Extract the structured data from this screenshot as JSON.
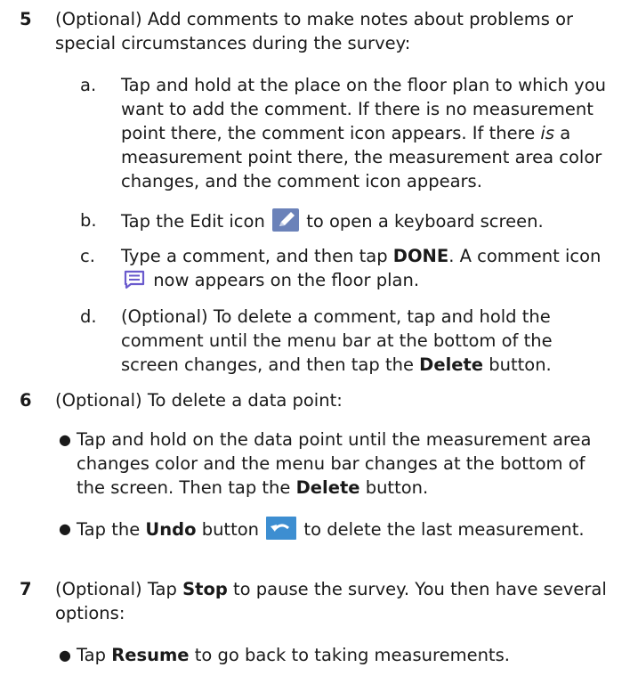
{
  "steps": [
    {
      "number": "5",
      "text": "(Optional) Add comments to make notes about problems or special circumstances during the survey:",
      "substeps": [
        {
          "letter": "a.",
          "text_1": "Tap and hold at the place on the floor plan to which you want to add the comment. If there is no measurement point there, the comment icon appears. If there ",
          "text_italic": "is",
          "text_2": " a measurement point there, the measurement area color changes, and the comment icon appears."
        },
        {
          "letter": "b.",
          "text_1": "Tap the Edit icon ",
          "icon": "edit-icon",
          "text_2": " to open a keyboard screen."
        },
        {
          "letter": "c.",
          "text_1": "Type a comment, and then tap ",
          "bold": "DONE",
          "text_2": ". A comment icon ",
          "icon": "comment-icon",
          "text_3": " now appears on the floor plan."
        },
        {
          "letter": "d.",
          "text_1": "(Optional) To delete a comment, tap and hold the comment until the menu bar at the bottom of the screen changes, and then tap the ",
          "bold": "Delete",
          "text_2": " button."
        }
      ]
    },
    {
      "number": "6",
      "text": "(Optional) To delete a data point:",
      "bullets": [
        {
          "text_1": "Tap and hold on the data point until the measurement area changes color and the menu bar changes at the bottom of the screen. Then tap the ",
          "bold": "Delete",
          "text_2": " button."
        },
        {
          "text_1": "Tap the ",
          "bold": "Undo",
          "text_2": " button ",
          "icon": "undo-icon",
          "text_3": " to delete the last measurement."
        }
      ]
    },
    {
      "number": "7",
      "text_1": "(Optional) Tap ",
      "bold": "Stop",
      "text_2": " to pause the survey. You then have several options:",
      "bullets": [
        {
          "text_1": "Tap ",
          "bold": "Resume",
          "text_2": " to go back to taking measurements."
        }
      ]
    }
  ],
  "colors": {
    "text": "#1a1a1a",
    "edit_icon": "#6b82b9",
    "comment_icon": "#6a5acd",
    "undo_icon": "#3d8ed1"
  }
}
